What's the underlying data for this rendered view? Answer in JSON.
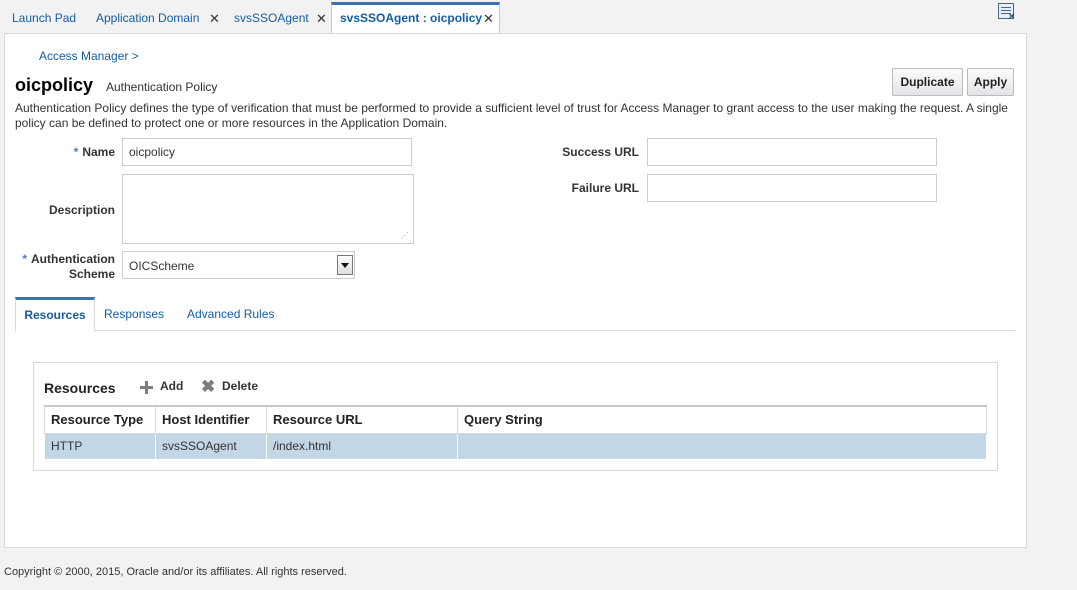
{
  "tabs": [
    {
      "label": "Launch Pad",
      "closable": false
    },
    {
      "label": "Application Domain",
      "closable": true
    },
    {
      "label": "svsSSOAgent",
      "closable": true
    },
    {
      "label": "svsSSOAgent : oicpolicy",
      "closable": true,
      "active": true
    }
  ],
  "toolbar_icon": "document-close-icon",
  "breadcrumb": "Access Manager >",
  "header": {
    "title": "oicpolicy",
    "subtitle": "Authentication Policy",
    "duplicate_label": "Duplicate",
    "apply_label": "Apply",
    "description": "Authentication Policy defines the type of verification that must be performed to provide a sufficient level of trust for Access Manager to grant access to the user making the request. A single policy can be defined to protect one or more resources in the Application Domain."
  },
  "form": {
    "required_marker": "*",
    "name_label": "Name",
    "name_value": "oicpolicy",
    "description_label": "Description",
    "description_value": "",
    "scheme_label_line1": "Authentication",
    "scheme_label_line2": "Scheme",
    "scheme_value": "OICScheme",
    "success_url_label": "Success URL",
    "success_url_value": "",
    "failure_url_label": "Failure URL",
    "failure_url_value": ""
  },
  "inner_tabs": [
    "Resources",
    "Responses",
    "Advanced Rules"
  ],
  "resources": {
    "title": "Resources",
    "add_label": "Add",
    "delete_label": "Delete",
    "columns": [
      "Resource Type",
      "Host Identifier",
      "Resource URL",
      "Query String"
    ],
    "rows": [
      [
        "HTTP",
        "svsSSOAgent",
        "/index.html",
        ""
      ]
    ]
  },
  "footer": "Copyright © 2000, 2015, Oracle and/or its affiliates. All rights reserved.",
  "colors": {
    "link": "#145c9e",
    "accent": "#3a74b0",
    "selected_row": "#c3d6e6"
  }
}
